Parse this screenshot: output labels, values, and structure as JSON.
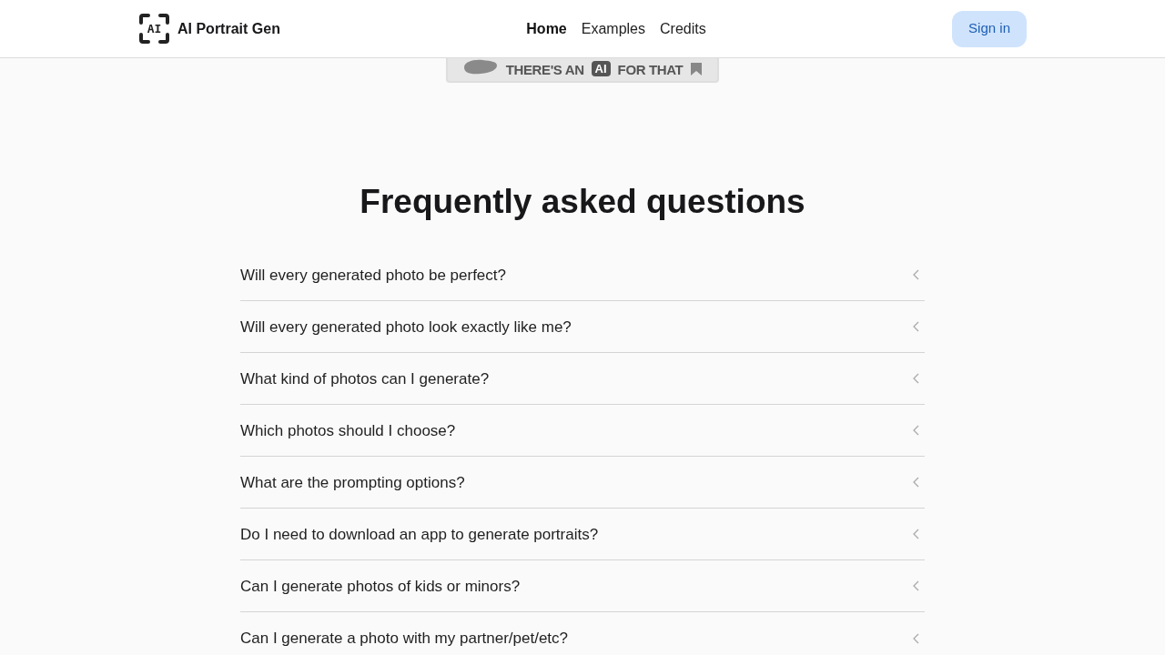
{
  "header": {
    "logo_mark": "AI",
    "brand": "AI Portrait Gen",
    "nav": [
      {
        "label": "Home",
        "selected": true
      },
      {
        "label": "Examples",
        "selected": false
      },
      {
        "label": "Credits",
        "selected": false
      }
    ],
    "sign_in": "Sign in"
  },
  "badge": {
    "before": "THERE'S AN",
    "boxed": "AI",
    "after": "FOR THAT"
  },
  "faq": {
    "title": "Frequently asked questions",
    "items": [
      {
        "question": "Will every generated photo be perfect?",
        "expanded": false
      },
      {
        "question": "Will every generated photo look exactly like me?",
        "expanded": false
      },
      {
        "question": "What kind of photos can I generate?",
        "expanded": false
      },
      {
        "question": "Which photos should I choose?",
        "expanded": false
      },
      {
        "question": "What are the prompting options?",
        "expanded": false
      },
      {
        "question": "Do I need to download an app to generate portraits?",
        "expanded": false
      },
      {
        "question": "Can I generate photos of kids or minors?",
        "expanded": false
      },
      {
        "question": "Can I generate a photo with my partner/pet/etc?",
        "expanded": false
      }
    ]
  }
}
